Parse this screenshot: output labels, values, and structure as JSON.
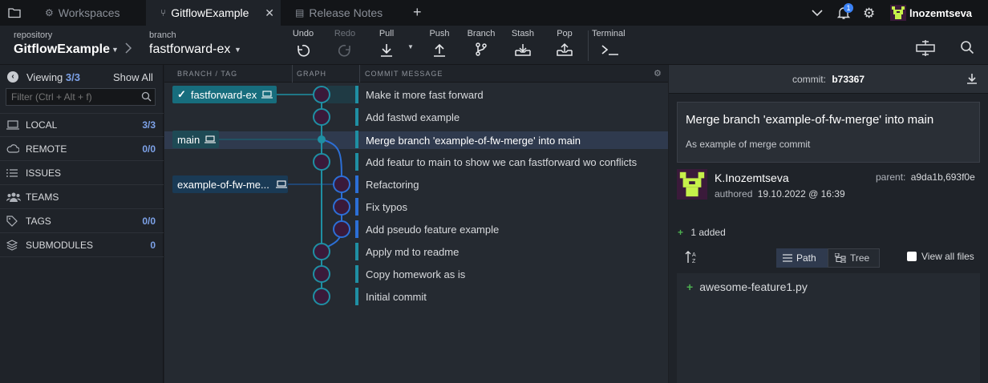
{
  "tabs": [
    {
      "label": "Workspaces",
      "active": false
    },
    {
      "label": "GitflowExample",
      "active": true
    },
    {
      "label": "Release Notes",
      "active": false
    }
  ],
  "user": {
    "name": "lnozemtseva",
    "notification_count": "1"
  },
  "toolbar": {
    "repository_label": "repository",
    "repository": "GitflowExample",
    "branch_label": "branch",
    "branch": "fastforward-ex",
    "buttons": [
      {
        "label": "Undo",
        "enabled": true
      },
      {
        "label": "Redo",
        "enabled": false
      },
      {
        "label": "Pull",
        "enabled": true
      },
      {
        "label": "Push",
        "enabled": true
      },
      {
        "label": "Branch",
        "enabled": true
      },
      {
        "label": "Stash",
        "enabled": true
      },
      {
        "label": "Pop",
        "enabled": true
      },
      {
        "label": "Terminal",
        "enabled": true
      }
    ]
  },
  "sidebar": {
    "viewing_label": "Viewing",
    "viewing_count": "3/3",
    "show_all": "Show All",
    "filter_placeholder": "Filter (Ctrl + Alt + f)",
    "sections": [
      {
        "label": "LOCAL",
        "count": "3/3",
        "icon": "laptop-icon"
      },
      {
        "label": "REMOTE",
        "count": "0/0",
        "icon": "cloud-icon"
      },
      {
        "label": "ISSUES",
        "count": "",
        "icon": "list-icon"
      },
      {
        "label": "TEAMS",
        "count": "",
        "icon": "people-icon"
      },
      {
        "label": "TAGS",
        "count": "0/0",
        "icon": "tag-icon"
      },
      {
        "label": "SUBMODULES",
        "count": "0",
        "icon": "layers-icon"
      }
    ]
  },
  "graph": {
    "col_branch": "BRANCH / TAG",
    "col_graph": "GRAPH",
    "col_message": "COMMIT MESSAGE",
    "branches": [
      {
        "label": "fastforward-ex",
        "checked": true
      },
      {
        "label": "main",
        "checked": false
      },
      {
        "label": "example-of-fw-me...",
        "checked": false
      }
    ],
    "commits": [
      {
        "message": "Make it more fast forward"
      },
      {
        "message": "Add fastwd example"
      },
      {
        "message": "Merge branch 'example-of-fw-merge' into main"
      },
      {
        "message": "Add featur to main to show we can fastforward wo conflicts"
      },
      {
        "message": "Refactoring"
      },
      {
        "message": "Fix typos"
      },
      {
        "message": "Add pseudo feature example"
      },
      {
        "message": "Apply md to readme"
      },
      {
        "message": "Copy homework as is"
      },
      {
        "message": "Initial commit"
      }
    ]
  },
  "detail": {
    "commit_label": "commit:",
    "commit_sha": "b73367",
    "summary": "Merge branch 'example-of-fw-merge' into main",
    "description": "As example of merge commit",
    "author": "K.Inozemtseva",
    "authored_label": "authored",
    "authored_date": "19.10.2022 @ 16:39",
    "parent_label": "parent:",
    "parents": "a9da1b,693f0e",
    "added_summary": "1 added",
    "view_path": "Path",
    "view_tree": "Tree",
    "view_all_files": "View all files",
    "files": [
      {
        "name": "awesome-feature1.py",
        "status": "added"
      }
    ]
  },
  "colors": {
    "accent": "#1f8fa3",
    "branch_active": "#176d7d",
    "branch_other": "#1a3a55",
    "added": "#4caf50",
    "selected_row": "#2f3a4e"
  }
}
